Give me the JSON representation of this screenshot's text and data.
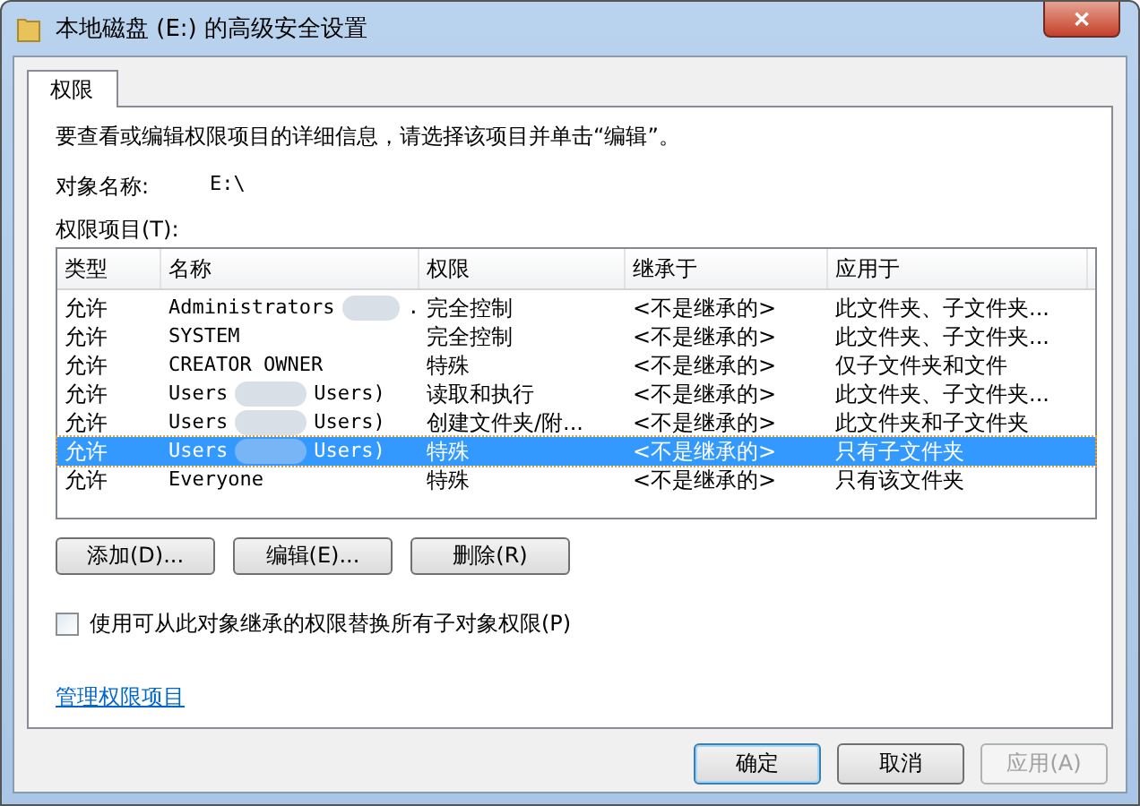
{
  "window": {
    "title": "本地磁盘 (E:) 的高级安全设置",
    "close": "✕"
  },
  "tabs": [
    {
      "label": "权限",
      "selected": true
    }
  ],
  "instruction": "要查看或编辑权限项目的详细信息，请选择该项目并单击“编辑”。",
  "object_name": {
    "label": "对象名称:",
    "value": "E:\\"
  },
  "list_label": "权限项目(T):",
  "table": {
    "columns": [
      "类型",
      "名称",
      "权限",
      "继承于",
      "应用于"
    ],
    "rows": [
      {
        "type": "允许",
        "name": [
          "Administrators",
          "."
        ],
        "redacted": true,
        "permission": "完全控制",
        "inherited_from": "<不是继承的>",
        "applies_to": "此文件夹、子文件夹...",
        "selected": false
      },
      {
        "type": "允许",
        "name": [
          "SYSTEM"
        ],
        "redacted": false,
        "permission": "完全控制",
        "inherited_from": "<不是继承的>",
        "applies_to": "此文件夹、子文件夹...",
        "selected": false
      },
      {
        "type": "允许",
        "name": [
          "CREATOR OWNER"
        ],
        "redacted": false,
        "permission": "特殊",
        "inherited_from": "<不是继承的>",
        "applies_to": "仅子文件夹和文件",
        "selected": false
      },
      {
        "type": "允许",
        "name": [
          "Users",
          "Users)"
        ],
        "redacted": true,
        "permission": "读取和执行",
        "inherited_from": "<不是继承的>",
        "applies_to": "此文件夹、子文件夹...",
        "selected": false
      },
      {
        "type": "允许",
        "name": [
          "Users",
          "Users)"
        ],
        "redacted": true,
        "permission": "创建文件夹/附...",
        "inherited_from": "<不是继承的>",
        "applies_to": "此文件夹和子文件夹",
        "selected": false
      },
      {
        "type": "允许",
        "name": [
          "Users",
          "Users)"
        ],
        "redacted": true,
        "permission": "特殊",
        "inherited_from": "<不是继承的>",
        "applies_to": "只有子文件夹",
        "selected": true
      },
      {
        "type": "允许",
        "name": [
          "Everyone"
        ],
        "redacted": false,
        "permission": "特殊",
        "inherited_from": "<不是继承的>",
        "applies_to": "只有该文件夹",
        "selected": false
      }
    ]
  },
  "actions": [
    {
      "label": "添加(D)..."
    },
    {
      "label": "编辑(E)..."
    },
    {
      "label": "删除(R)"
    }
  ],
  "replace_checkbox": {
    "label": "使用可从此对象继承的权限替换所有子对象权限(P)",
    "checked": false
  },
  "manage_link": "管理权限项目",
  "footer_buttons": [
    {
      "label": "确定",
      "default": true,
      "disabled": false
    },
    {
      "label": "取消",
      "default": false,
      "disabled": false
    },
    {
      "label": "应用(A)",
      "default": false,
      "disabled": true
    }
  ]
}
